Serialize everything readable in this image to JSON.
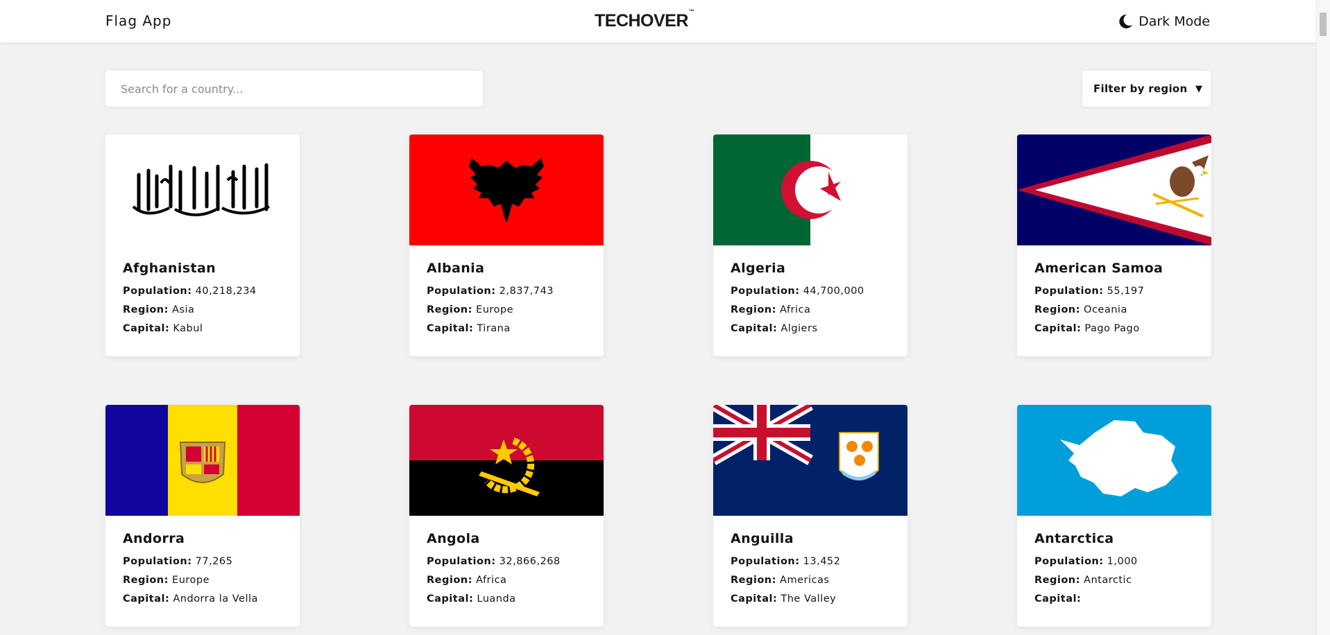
{
  "header": {
    "app_title": "Flag App",
    "logo_text": "TECHOVER",
    "logo_tm": "™",
    "dark_mode_label": "Dark Mode",
    "dark_mode_icon": "moon-icon"
  },
  "toolbar": {
    "search_placeholder": "Search for a country...",
    "filter_label": "Filter by region",
    "filter_caret": "▼"
  },
  "labels": {
    "population": "Population:",
    "region": "Region:",
    "capital": "Capital:"
  },
  "countries": [
    {
      "name": "Afghanistan",
      "population": "40,218,234",
      "region": "Asia",
      "capital": "Kabul"
    },
    {
      "name": "Albania",
      "population": "2,837,743",
      "region": "Europe",
      "capital": "Tirana"
    },
    {
      "name": "Algeria",
      "population": "44,700,000",
      "region": "Africa",
      "capital": "Algiers"
    },
    {
      "name": "American Samoa",
      "population": "55,197",
      "region": "Oceania",
      "capital": "Pago Pago"
    },
    {
      "name": "Andorra",
      "population": "77,265",
      "region": "Europe",
      "capital": "Andorra la Vella"
    },
    {
      "name": "Angola",
      "population": "32,866,268",
      "region": "Africa",
      "capital": "Luanda"
    },
    {
      "name": "Anguilla",
      "population": "13,452",
      "region": "Americas",
      "capital": "The Valley"
    },
    {
      "name": "Antarctica",
      "population": "1,000",
      "region": "Antarctic",
      "capital": ""
    }
  ],
  "colors": {
    "background": "#f2f2f2",
    "card": "#ffffff",
    "text": "#111517"
  }
}
